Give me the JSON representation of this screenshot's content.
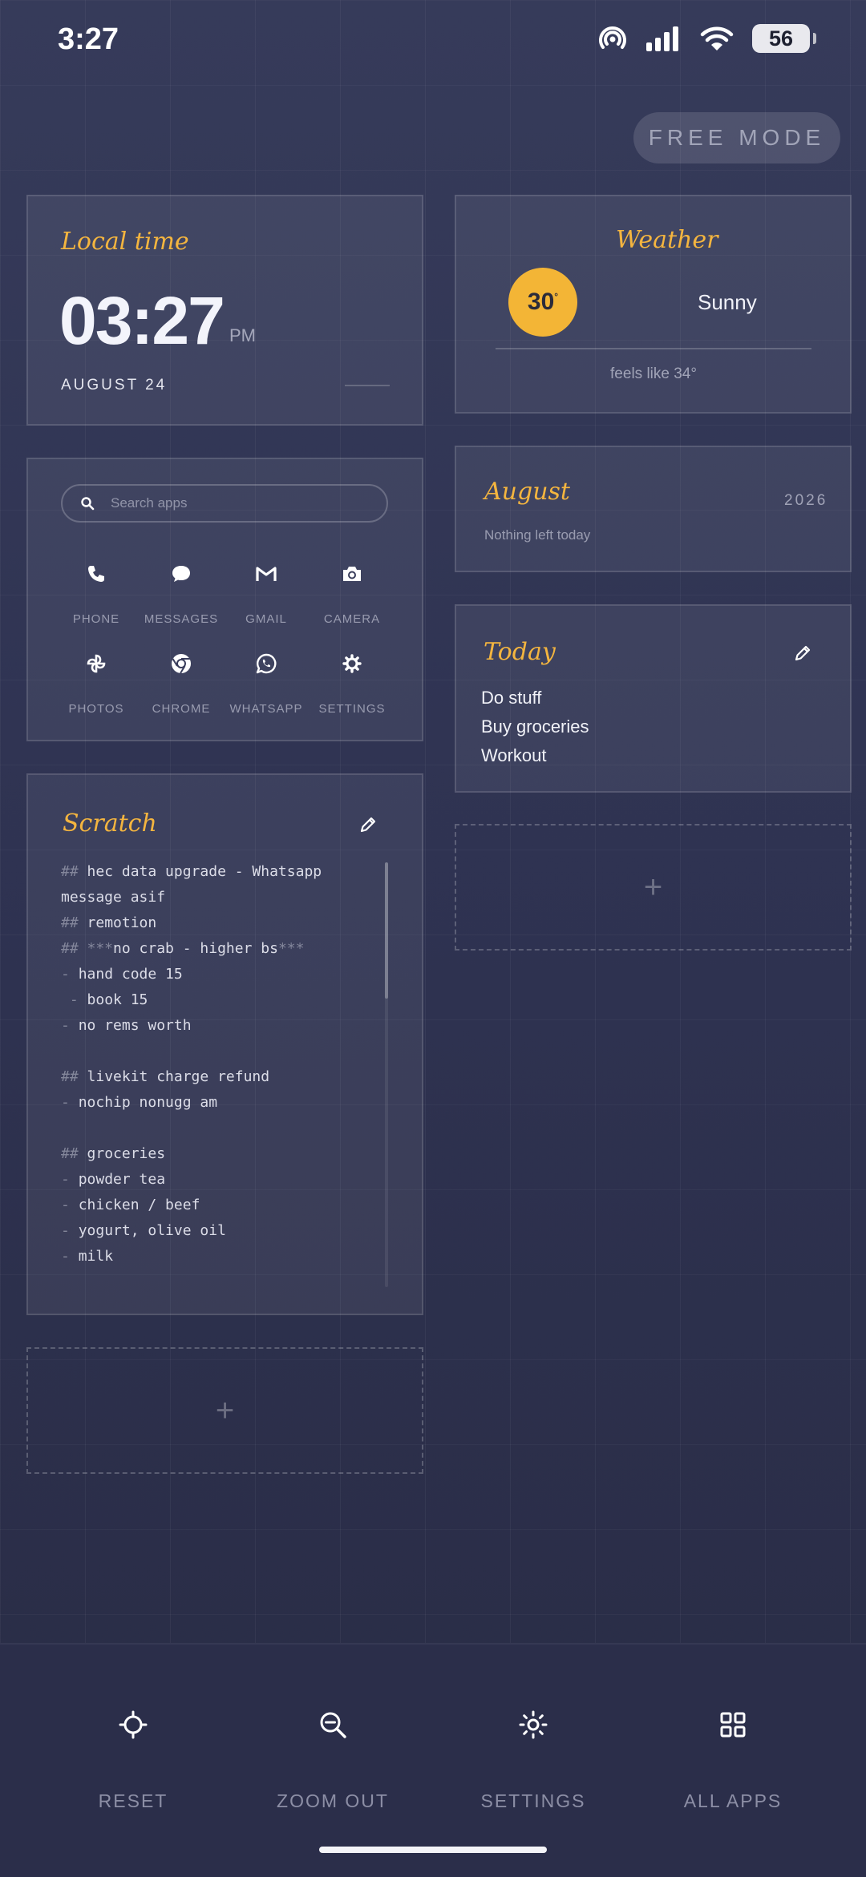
{
  "status_bar": {
    "time": "3:27",
    "battery": "56"
  },
  "free_mode_label": "FREE MODE",
  "local_time": {
    "title": "Local time",
    "time": "03:27",
    "ampm": "PM",
    "date": "AUGUST 24"
  },
  "weather": {
    "title": "Weather",
    "temp": "30",
    "degree": "°",
    "condition": "Sunny",
    "feels_like": "feels like 34°"
  },
  "calendar": {
    "title": "August",
    "year": "2026",
    "subtitle": "Nothing left today"
  },
  "today": {
    "title": "Today",
    "items": [
      "Do stuff",
      "Buy groceries",
      "Workout"
    ]
  },
  "apps": {
    "search_placeholder": "Search apps",
    "items": [
      {
        "label": "PHONE",
        "icon": "phone-icon"
      },
      {
        "label": "MESSAGES",
        "icon": "chat-bubble-icon"
      },
      {
        "label": "GMAIL",
        "icon": "gmail-icon"
      },
      {
        "label": "CAMERA",
        "icon": "camera-icon"
      },
      {
        "label": "PHOTOS",
        "icon": "pinwheel-icon"
      },
      {
        "label": "CHROME",
        "icon": "chrome-icon"
      },
      {
        "label": "WHATSAPP",
        "icon": "whatsapp-icon"
      },
      {
        "label": "SETTINGS",
        "icon": "gear-icon"
      }
    ]
  },
  "scratch": {
    "title": "Scratch",
    "lines": [
      {
        "md": "## ",
        "text": "hec data upgrade - Whatsapp"
      },
      {
        "md": "",
        "text": "message asif"
      },
      {
        "md": "## ",
        "text": "remotion"
      },
      {
        "md": "## ***",
        "text": "no crab - higher bs",
        "md_end": "***"
      },
      {
        "md": "- ",
        "text": "hand code 15"
      },
      {
        "md": " - ",
        "text": "book 15"
      },
      {
        "md": "- ",
        "text": "no rems worth"
      },
      {
        "md": "",
        "text": ""
      },
      {
        "md": "## ",
        "text": "livekit charge refund"
      },
      {
        "md": "- ",
        "text": "nochip nonugg am"
      },
      {
        "md": "",
        "text": ""
      },
      {
        "md": "## ",
        "text": "groceries"
      },
      {
        "md": "- ",
        "text": "powder tea"
      },
      {
        "md": "- ",
        "text": "chicken / beef"
      },
      {
        "md": "- ",
        "text": "yogurt, olive oil"
      },
      {
        "md": "- ",
        "text": "milk"
      }
    ]
  },
  "add_widget_symbol": "+",
  "bottom_bar": {
    "reset": "RESET",
    "zoom_out": "ZOOM OUT",
    "settings": "SETTINGS",
    "all_apps": "ALL APPS"
  },
  "colors": {
    "accent": "#f4b53f",
    "background": "#2f3352"
  }
}
